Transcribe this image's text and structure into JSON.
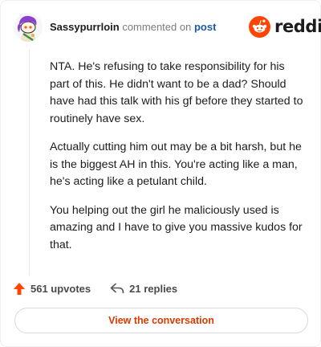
{
  "header": {
    "username": "Sassypurrloin",
    "verb": "commented on",
    "post_link": "post",
    "logo_text": "reddit"
  },
  "comment": {
    "paragraphs": [
      "NTA. He's refusing to take responsibility for his part of this. He didn't want to be a dad? Should have had this talk with his gf before they started to routinely have sex.",
      "Actually cutting him out may be a bit harsh, but he is the biggest AH in this. You're acting like a man, he's acting like a petulant child.",
      "You helping out the girl he maliciously used is amazing and I have to give you massive kudos for that."
    ]
  },
  "actions": {
    "upvotes": "561 upvotes",
    "replies": "21 replies"
  },
  "button": {
    "label": "View the conversation"
  },
  "icons": {
    "avatar": "snoo-avatar",
    "logo": "reddit-snoo-logo",
    "upvote": "upvote-arrow-icon",
    "reply": "reply-arrow-icon"
  },
  "colors": {
    "brand": "#ff4500",
    "link": "#1c5aa8",
    "button_text": "#d93a00"
  }
}
